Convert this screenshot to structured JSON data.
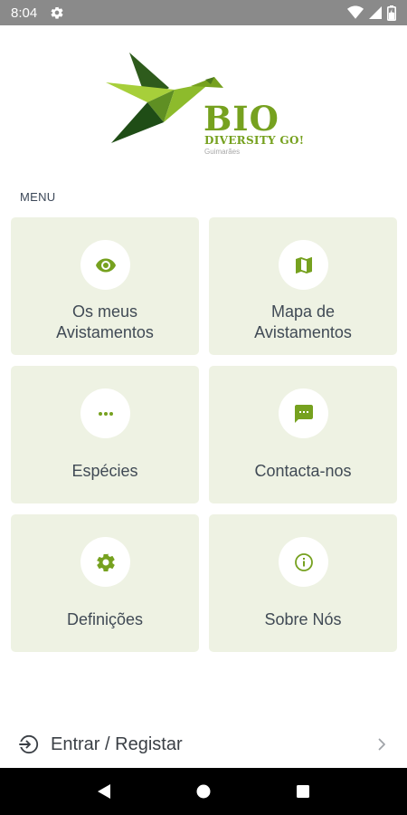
{
  "status_bar": {
    "time": "8:04",
    "icons": [
      "gear-icon",
      "wifi-icon",
      "signal-icon",
      "battery-icon"
    ]
  },
  "logo": {
    "title": "BIO",
    "subtitle": "DIVERSITY GO!",
    "city": "Guimarães"
  },
  "menu": {
    "label": "MENU",
    "items": [
      {
        "label_lines": [
          "Os meus",
          "Avistamentos"
        ],
        "icon": "eye-icon"
      },
      {
        "label_lines": [
          "Mapa de",
          "Avistamentos"
        ],
        "icon": "map-icon"
      },
      {
        "label_lines": [
          "Espécies"
        ],
        "icon": "more-dots-icon"
      },
      {
        "label_lines": [
          "Contacta-nos"
        ],
        "icon": "chat-icon"
      },
      {
        "label_lines": [
          "Definições"
        ],
        "icon": "settings-gear-icon"
      },
      {
        "label_lines": [
          "Sobre Nós"
        ],
        "icon": "info-icon"
      }
    ]
  },
  "login": {
    "label": "Entrar / Registar",
    "icon": "login-arrow-icon"
  },
  "colors": {
    "accent": "#76a11f",
    "card_bg": "#eef2e3",
    "status_bar": "#8a8a8a",
    "nav_bar": "#000000"
  }
}
